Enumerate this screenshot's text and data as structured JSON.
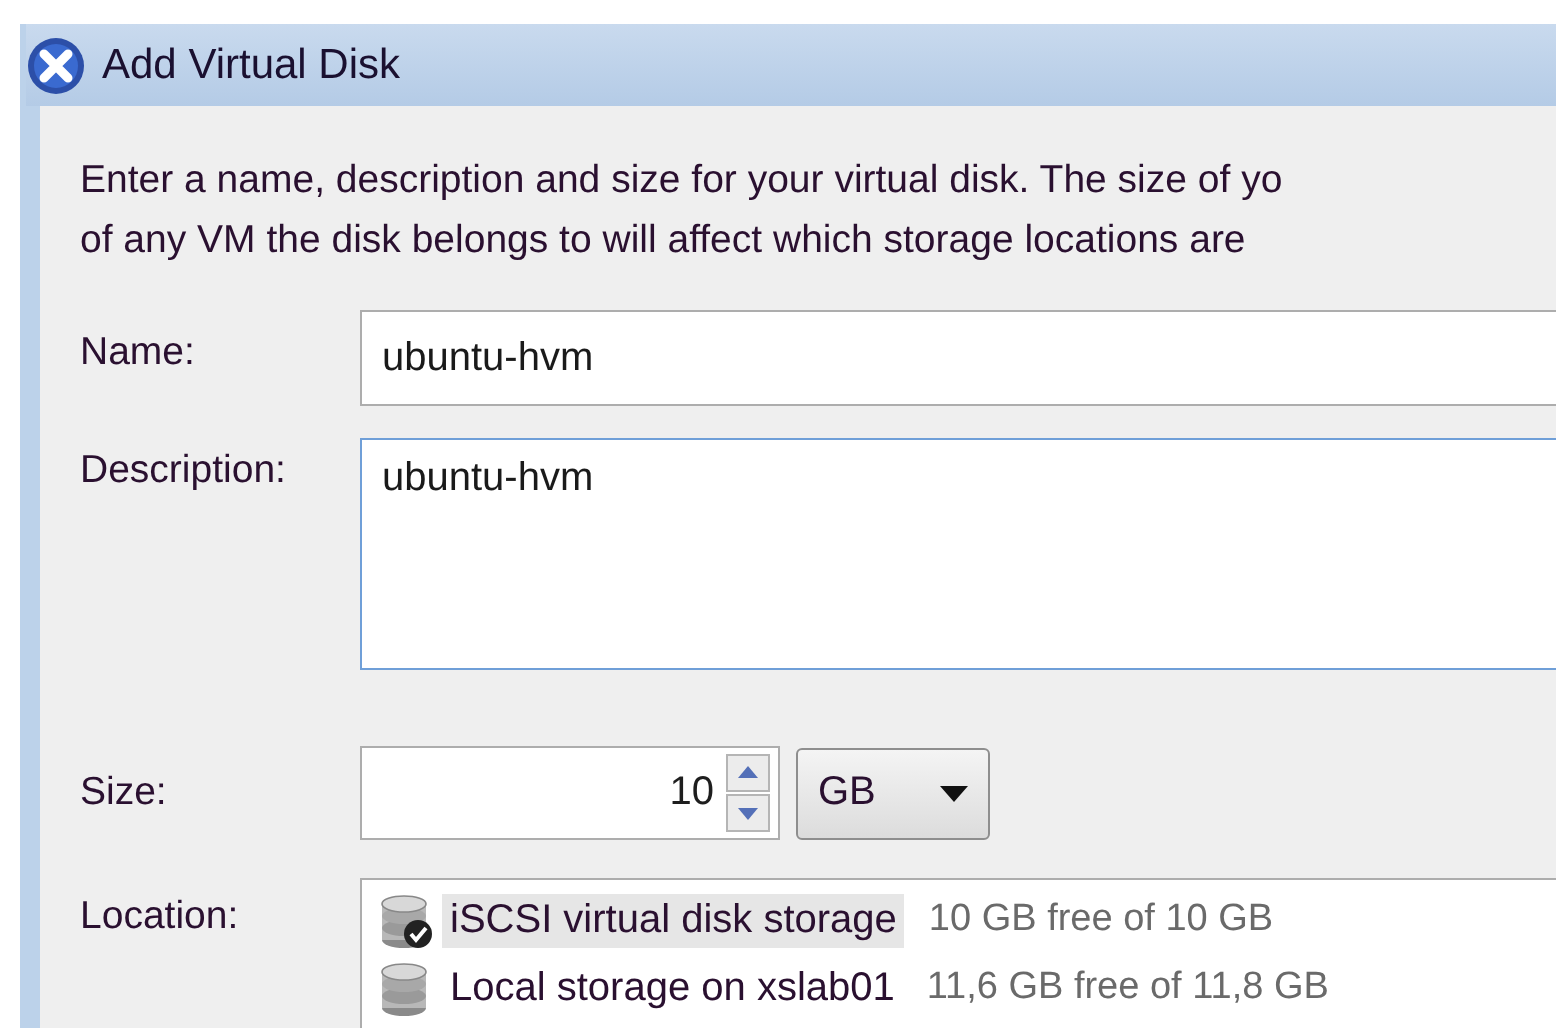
{
  "window": {
    "title": "Add Virtual Disk"
  },
  "intro": [
    "Enter a name, description and size for your virtual disk. The size of yo",
    "of any VM the disk belongs to will affect which storage locations are"
  ],
  "name": {
    "label": "Name:",
    "value": "ubuntu-hvm"
  },
  "description": {
    "label": "Description:",
    "value": "ubuntu-hvm"
  },
  "size": {
    "label": "Size:",
    "value": "10",
    "unit": "GB"
  },
  "location": {
    "label": "Location:",
    "items": [
      {
        "name": "iSCSI virtual disk storage",
        "free": "10 GB free of 10 GB",
        "selected": true,
        "default": true
      },
      {
        "name": "Local storage on xslab01",
        "free": "11,6 GB free of 11,8 GB",
        "selected": false,
        "default": false
      }
    ]
  }
}
